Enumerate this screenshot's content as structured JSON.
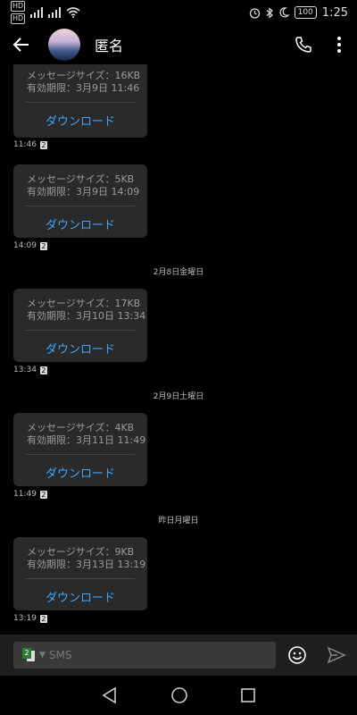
{
  "status_bar": {
    "time": "1:25",
    "battery": "100",
    "hd": "HD"
  },
  "header": {
    "title": "匿名"
  },
  "messages": [
    {
      "size": "メッセージサイズ：16KB",
      "expiry": "有効期限：3月9日 11:46",
      "download_label": "ダウンロード",
      "time": "11:46",
      "sim": "2"
    },
    {
      "size": "メッセージサイズ：5KB",
      "expiry": "有効期限：3月9日 14:09",
      "download_label": "ダウンロード",
      "time": "14:09",
      "sim": "2"
    },
    {
      "size": "メッセージサイズ：17KB",
      "expiry": "有効期限：3月10日 13:34",
      "download_label": "ダウンロード",
      "time": "13:34",
      "sim": "2"
    },
    {
      "size": "メッセージサイズ：4KB",
      "expiry": "有効期限：3月11日 11:49",
      "download_label": "ダウンロード",
      "time": "11:49",
      "sim": "2"
    },
    {
      "size": "メッセージサイズ：9KB",
      "expiry": "有効期限：3月13日 13:19",
      "download_label": "ダウンロード",
      "time": "13:19",
      "sim": "2"
    }
  ],
  "date_separators": [
    "2月8日金曜日",
    "2月9日土曜日",
    "昨日月曜日"
  ],
  "composer": {
    "placeholder": "SMS",
    "sim_label": "2"
  },
  "colors": {
    "accent": "#3ea6ff",
    "card": "#2a2a2a",
    "background": "#000000"
  }
}
